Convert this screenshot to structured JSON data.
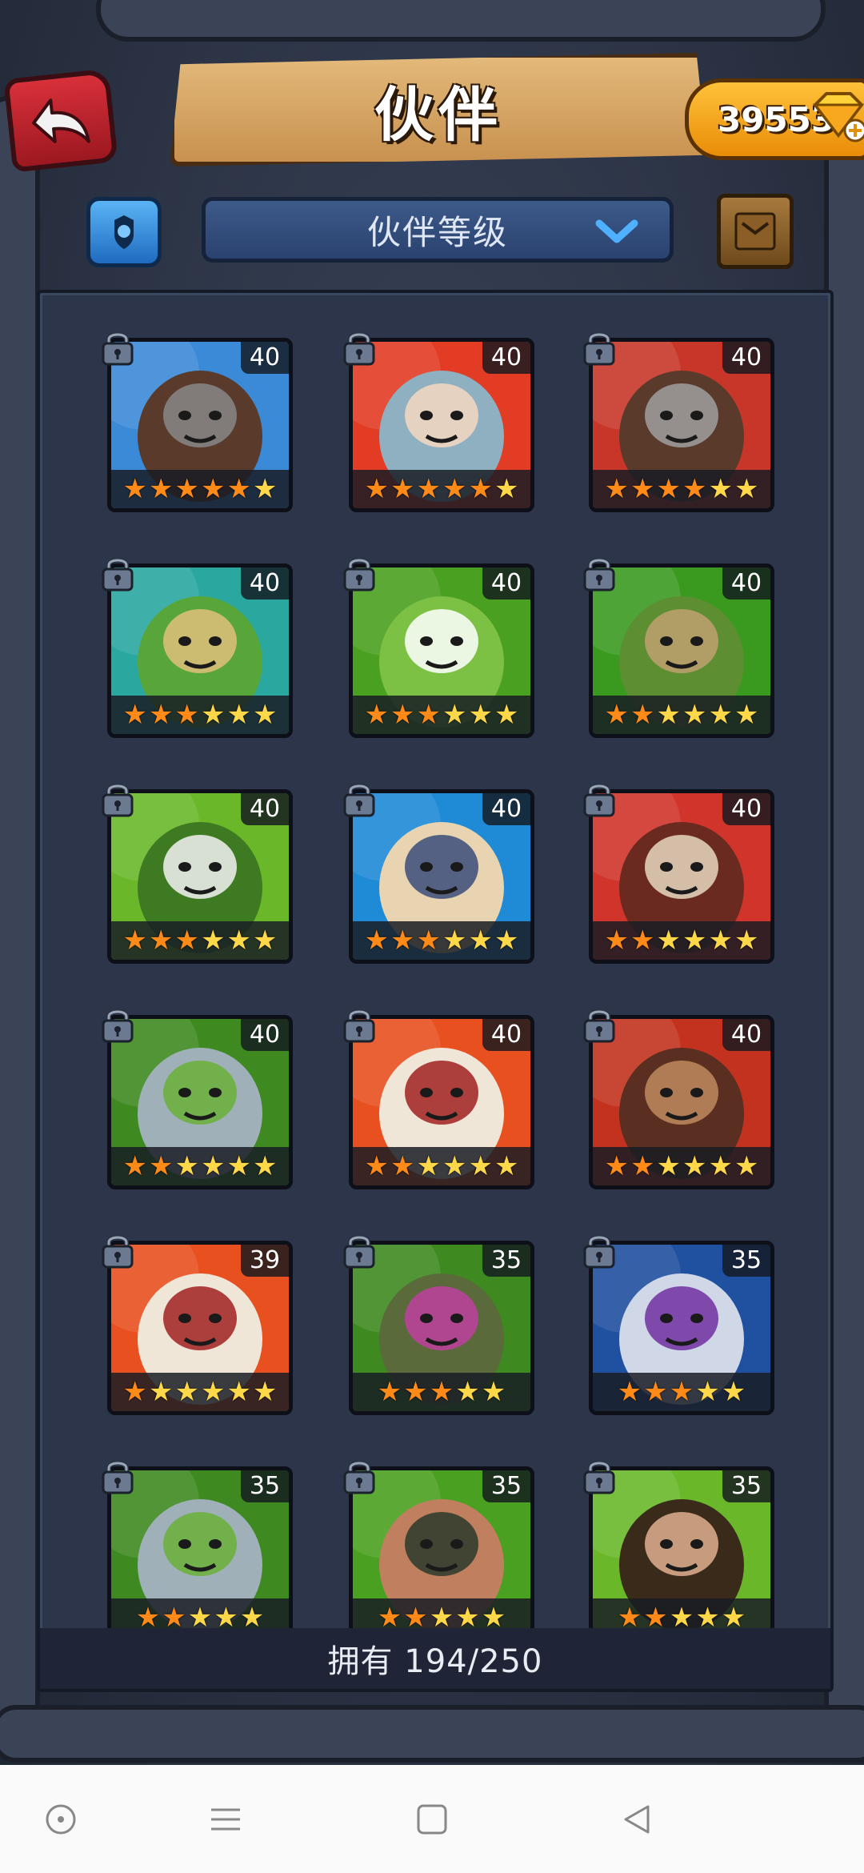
{
  "header": {
    "title": "伙伴",
    "currency_value": "39553"
  },
  "filter": {
    "dropdown_label": "伙伴等级"
  },
  "partners": [
    {
      "level": "40",
      "stars": 6,
      "orange": 5,
      "colors": [
        "#3a8ad8",
        "#5a3a2a",
        "#888"
      ]
    },
    {
      "level": "40",
      "stars": 6,
      "orange": 5,
      "colors": [
        "#e23c24",
        "#8fb0c0",
        "#f5d8c0"
      ]
    },
    {
      "level": "40",
      "stars": 6,
      "orange": 4,
      "colors": [
        "#c8362a",
        "#5a3a2a",
        "#a0a0a0"
      ]
    },
    {
      "level": "40",
      "stars": 6,
      "orange": 3,
      "colors": [
        "#2aa8a0",
        "#58a63a",
        "#e1c07c"
      ]
    },
    {
      "level": "40",
      "stars": 6,
      "orange": 3,
      "colors": [
        "#4aa020",
        "#7cc044",
        "#ffffff"
      ]
    },
    {
      "level": "40",
      "stars": 6,
      "orange": 2,
      "colors": [
        "#3a9a20",
        "#5e8e32",
        "#c0a070"
      ]
    },
    {
      "level": "40",
      "stars": 6,
      "orange": 3,
      "colors": [
        "#6ab82a",
        "#3e7a22",
        "#f2f2f2"
      ]
    },
    {
      "level": "40",
      "stars": 6,
      "orange": 3,
      "colors": [
        "#1f8ad6",
        "#e8d4b0",
        "#3a4c7a"
      ]
    },
    {
      "level": "40",
      "stars": 6,
      "orange": 2,
      "colors": [
        "#d0342a",
        "#6a2a20",
        "#e8d8c0"
      ]
    },
    {
      "level": "40",
      "stars": 6,
      "orange": 2,
      "colors": [
        "#3e8a20",
        "#a0b0b8",
        "#6ab038"
      ]
    },
    {
      "level": "40",
      "stars": 6,
      "orange": 2,
      "colors": [
        "#e85020",
        "#f0e6d8",
        "#a02020"
      ]
    },
    {
      "level": "40",
      "stars": 6,
      "orange": 2,
      "colors": [
        "#c2321e",
        "#5a2e20",
        "#c08a60"
      ]
    },
    {
      "level": "39",
      "stars": 6,
      "orange": 1,
      "colors": [
        "#e85020",
        "#f0e6d8",
        "#a02020"
      ]
    },
    {
      "level": "35",
      "stars": 5,
      "orange": 3,
      "colors": [
        "#3e8a20",
        "#5a6a3a",
        "#c040a0"
      ]
    },
    {
      "level": "35",
      "stars": 5,
      "orange": 3,
      "colors": [
        "#2050a0",
        "#d0d8e8",
        "#7030a0"
      ]
    },
    {
      "level": "35",
      "stars": 5,
      "orange": 2,
      "colors": [
        "#3e8a20",
        "#a0b0b8",
        "#6ab038"
      ]
    },
    {
      "level": "35",
      "stars": 5,
      "orange": 2,
      "colors": [
        "#4aa020",
        "#c08060",
        "#2a3a2a"
      ]
    },
    {
      "level": "35",
      "stars": 5,
      "orange": 2,
      "colors": [
        "#6ab82a",
        "#3a2a1a",
        "#e0b090"
      ]
    }
  ],
  "footer": {
    "owned_text": "拥有 194/250"
  },
  "icons": {
    "back": "back-arrow-icon",
    "gem": "gem-plus-icon",
    "filter": "filter-icon",
    "dropdown": "chevron-down-icon",
    "book": "book-icon",
    "lock": "lock-icon",
    "nav_home": "circle-dot-icon",
    "nav_menu": "menu-icon",
    "nav_square": "square-icon",
    "nav_back": "triangle-back-icon"
  }
}
